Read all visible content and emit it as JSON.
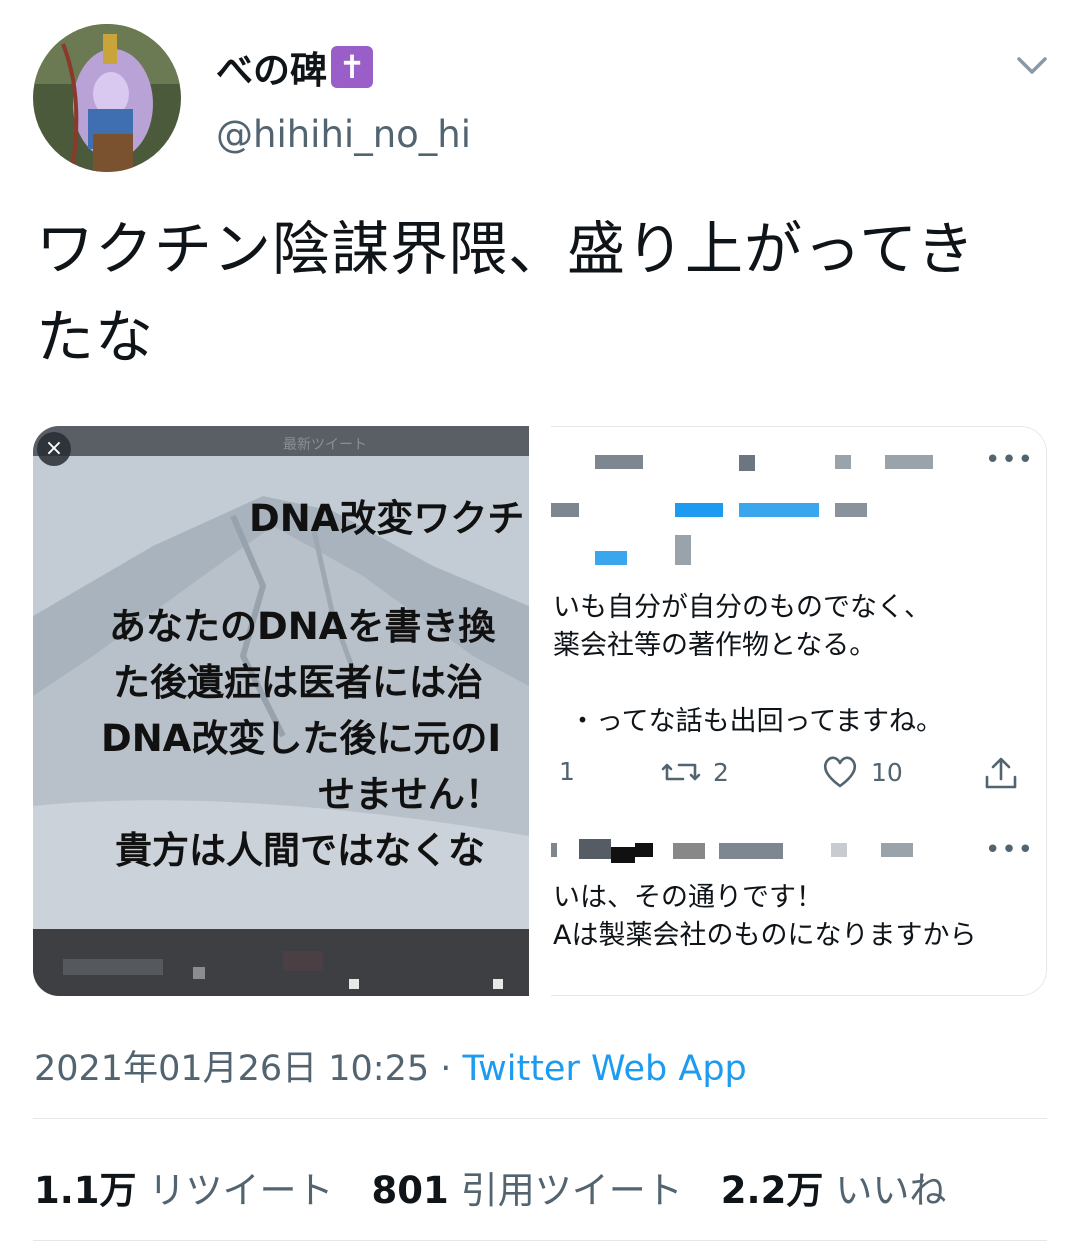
{
  "author": {
    "display_name": "べの碑",
    "badge": "✝",
    "handle": "@hihihi_no_hi"
  },
  "tweet": {
    "text_line1": "ワクチン陰謀界隈、盛り上がってき",
    "text_line2": "たな"
  },
  "media_left": {
    "topbar_label": "最新ツイート",
    "close": "×",
    "title": "DNA改変ワクチ",
    "line1": "あなたのDNAを書き換",
    "line2": "た後遺症は医者には治",
    "line3": "DNA改変した後に元のI",
    "line4": "せません！",
    "line5": "貴方は人間ではなくな"
  },
  "media_right": {
    "line1": "いも自分が自分のものでなく、",
    "line2": "薬会社等の著作物となる。",
    "line3": "・ってな話も出回ってますね。",
    "reply_count": "1",
    "retweet_count": "2",
    "like_count": "10",
    "line4": "いは、その通りです！",
    "line5": "Aは製薬会社のものになりますから"
  },
  "meta": {
    "date": "2021年01月26日 10:25",
    "separator": " · ",
    "app": "Twitter Web App"
  },
  "stats": {
    "retweets": "1.1万",
    "retweets_label": "リツイート",
    "quotes": "801",
    "quotes_label": "引用ツイート",
    "likes": "2.2万",
    "likes_label": "いいね"
  },
  "colors": {
    "accent": "#1d9bf0",
    "muted": "#536471",
    "badge": "#9a5ec9"
  }
}
